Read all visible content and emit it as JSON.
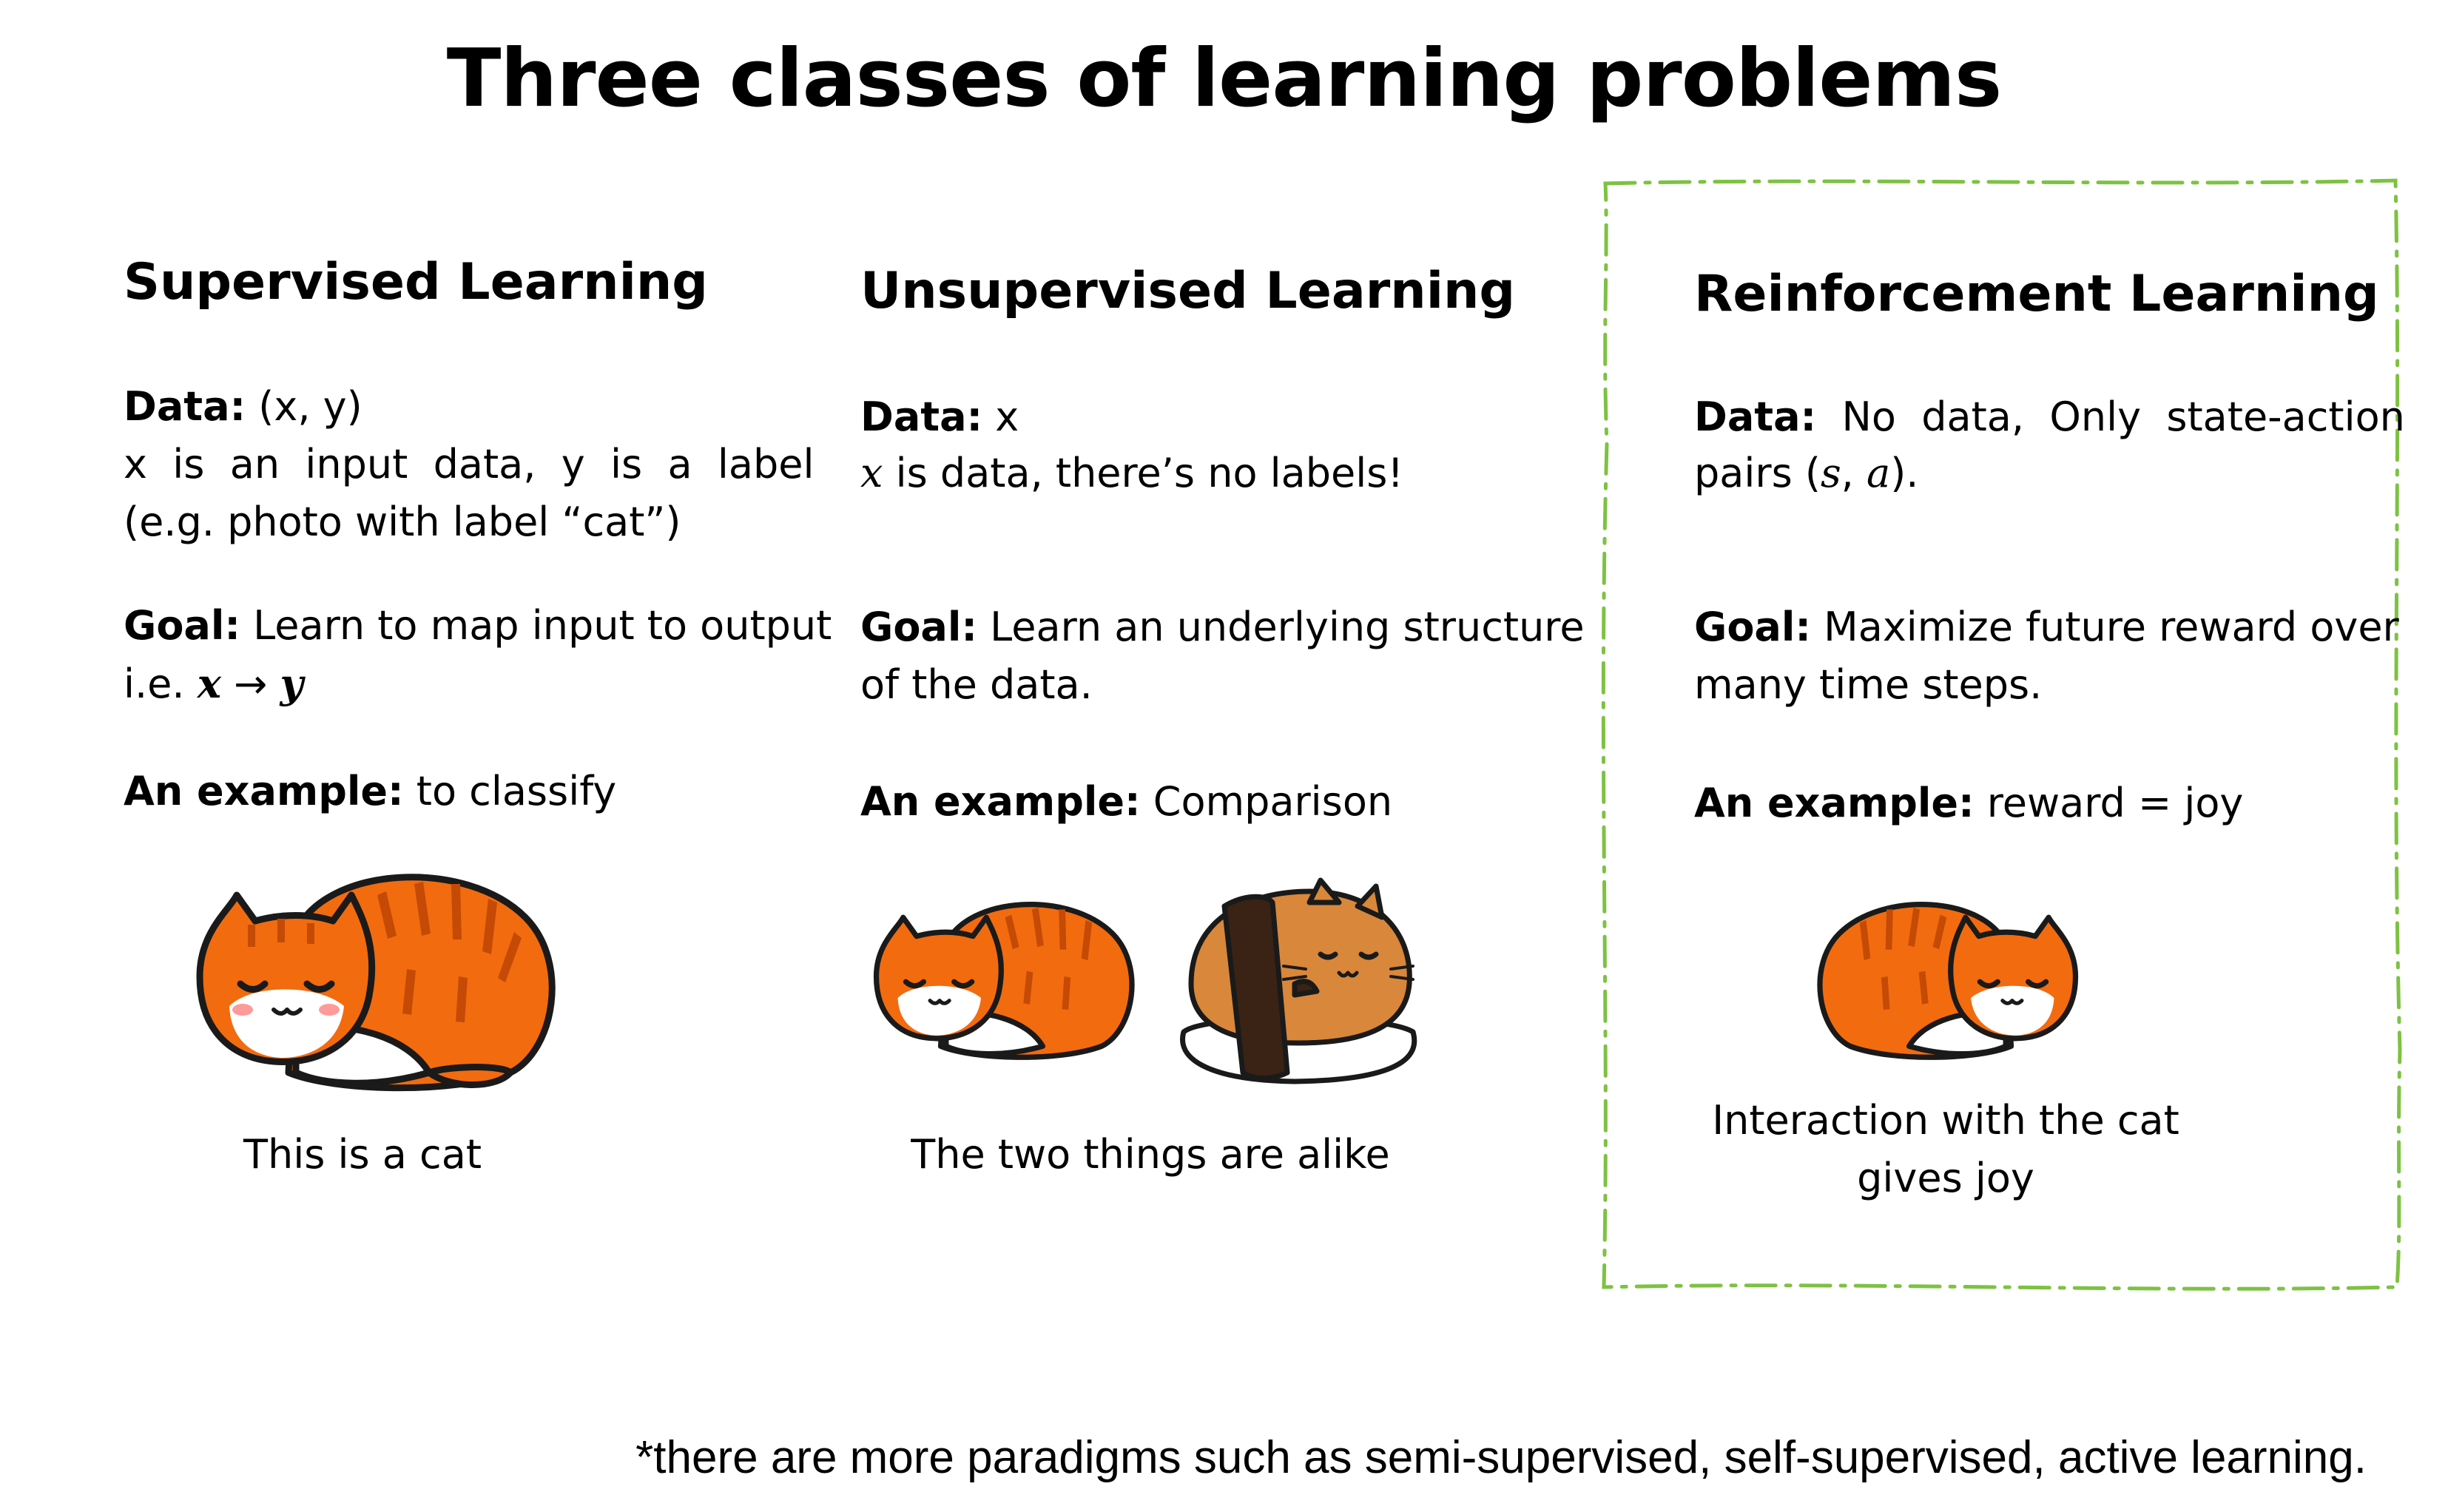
{
  "title": "Three classes of learning problems",
  "columns": [
    {
      "heading": "Supervised Learning",
      "data_label": "Data:",
      "data_value": "(x, y)",
      "data_line2": "x  is  an  input  data,  y  is  a  label",
      "data_line3": "(e.g. photo with label “cat”)",
      "goal_label": "Goal:",
      "goal_value": "Learn to map input to output",
      "goal_line2_prefix": "i.e. ",
      "goal_math_x": "x",
      "goal_arrow": " → ",
      "goal_math_y": "y",
      "example_label": "An example:",
      "example_value": "to classify",
      "caption": "This is a cat"
    },
    {
      "heading": "Unsupervised Learning",
      "data_label": "Data:",
      "data_value": "x",
      "data_math": "x",
      "data_line2_rest": " is data, there’s no labels!",
      "goal_label": "Goal:",
      "goal_value": "Learn an underlying structure",
      "goal_line2": "of the data.",
      "example_label": "An example:",
      "example_value": "Comparison",
      "caption": "The two things are alike"
    },
    {
      "heading": "Reinforcement Learning",
      "data_label": "Data:",
      "data_value": "No  data,  Only  state-action",
      "data_line2_prefix": "pairs (",
      "data_math_s": "s",
      "data_sep": ", ",
      "data_math_a": "a",
      "data_line2_suffix": ").",
      "goal_label": "Goal:",
      "goal_value": "Maximize future reward over",
      "goal_line2": "many time steps.",
      "example_label": "An example:",
      "example_value": "reward = joy",
      "caption_line1": "Interaction with the cat",
      "caption_line2": "gives joy"
    }
  ],
  "footnote": "*there are more paradigms such as semi-supervised, self-supervised, active learning.",
  "colors": {
    "text": "#000000",
    "frame": "#7dc242",
    "cat_orange": "#f26b0f",
    "cat_stripe": "#c44a05",
    "cat_white": "#ffffff",
    "cat_outline": "#1a1a1a",
    "bun": "#d9873b",
    "nori": "#3a2314",
    "rice": "#ffffff"
  },
  "icons": [
    "sleeping-cat-icon",
    "sushi-cat-icon",
    "sleeping-cat-small-icon"
  ]
}
